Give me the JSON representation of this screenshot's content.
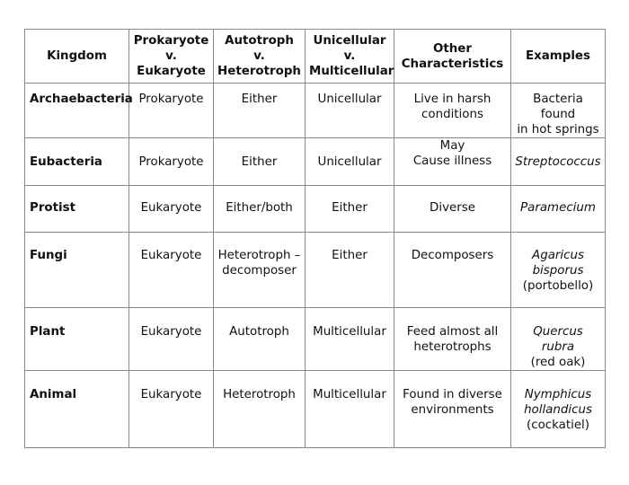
{
  "table": {
    "headers": [
      [
        "Kingdom"
      ],
      [
        "Prokaryote",
        "v.",
        "Eukaryote"
      ],
      [
        "Autotroph",
        "v.",
        "Heterotroph"
      ],
      [
        "Unicellular",
        "v.",
        "Multicellular"
      ],
      [
        "Other",
        "Characteristics"
      ],
      [
        "Examples"
      ]
    ],
    "rows": [
      {
        "kingdom": "Archaebacteria",
        "cell_type": "Prokaryote",
        "nutrition": "Either",
        "cellularity": "Unicellular",
        "other": [
          "Live in harsh",
          "conditions"
        ],
        "examples": [
          {
            "text": "Bacteria found",
            "italic": false
          },
          {
            "text": "in hot springs",
            "italic": false
          }
        ]
      },
      {
        "kingdom": "Eubacteria",
        "cell_type": "Prokaryote",
        "nutrition": "Either",
        "cellularity": "Unicellular",
        "other": [
          "May",
          "Cause illness"
        ],
        "examples": [
          {
            "text": "Streptococcus",
            "italic": true
          }
        ]
      },
      {
        "kingdom": "Protist",
        "cell_type": "Eukaryote",
        "nutrition": "Either/both",
        "cellularity": "Either",
        "other": [
          "Diverse"
        ],
        "examples": [
          {
            "text": "Paramecium",
            "italic": true
          }
        ]
      },
      {
        "kingdom": "Fungi",
        "cell_type": "Eukaryote",
        "nutrition": "Heterotroph –\ndecomposer",
        "cellularity": "Either",
        "other": [
          "Decomposers"
        ],
        "examples": [
          {
            "text": "Agaricus",
            "italic": true
          },
          {
            "text": "bisporus",
            "italic": true
          },
          {
            "text": "(portobello)",
            "italic": false
          }
        ]
      },
      {
        "kingdom": "Plant",
        "cell_type": "Eukaryote",
        "nutrition": "Autotroph",
        "cellularity": "Multicellular",
        "other": [
          "Feed almost all",
          "heterotrophs"
        ],
        "examples": [
          {
            "text": "Quercus rubra",
            "italic": true
          },
          {
            "text": "(red oak)",
            "italic": false
          }
        ]
      },
      {
        "kingdom": "Animal",
        "cell_type": "Eukaryote",
        "nutrition": "Heterotroph",
        "cellularity": "Multicellular",
        "other": [
          "Found in diverse",
          "environments"
        ],
        "examples": [
          {
            "text": "Nymphicus",
            "italic": true
          },
          {
            "text": "hollandicus",
            "italic": true
          },
          {
            "text": "(cockatiel)",
            "italic": false
          }
        ]
      }
    ]
  }
}
